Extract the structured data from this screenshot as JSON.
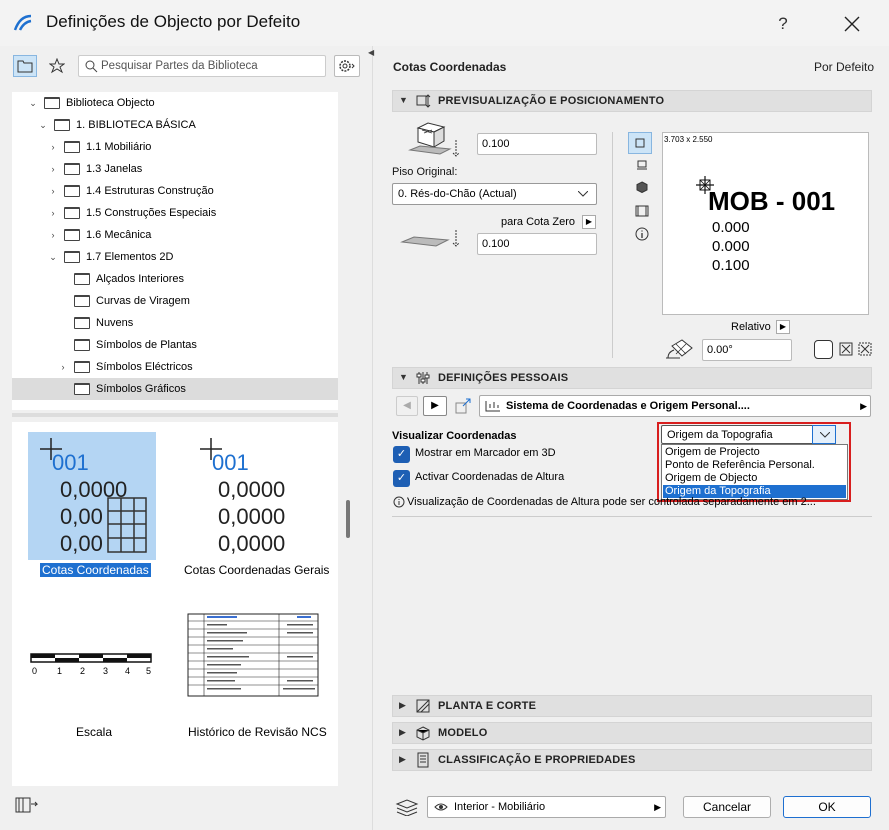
{
  "window": {
    "title": "Definições de Objecto por Defeito",
    "help": "?",
    "close": "✕"
  },
  "left": {
    "search_placeholder": "Pesquisar Partes da Biblioteca",
    "tree": [
      {
        "label": "Biblioteca Objecto",
        "expanded": true
      },
      {
        "label": "1. BIBLIOTECA BÁSICA",
        "expanded": true
      },
      {
        "label": "1.1 Mobiliário",
        "expanded": false
      },
      {
        "label": "1.3 Janelas",
        "expanded": false
      },
      {
        "label": "1.4 Estruturas Construção",
        "expanded": false
      },
      {
        "label": "1.5 Construções Especiais",
        "expanded": false
      },
      {
        "label": "1.6 Mecânica",
        "expanded": false
      },
      {
        "label": "1.7 Elementos 2D",
        "expanded": true
      },
      {
        "label": "Alçados Interiores"
      },
      {
        "label": "Curvas de Viragem"
      },
      {
        "label": "Nuvens"
      },
      {
        "label": "Símbolos de Plantas"
      },
      {
        "label": "Símbolos Eléctricos",
        "expanded": false
      },
      {
        "label": "Símbolos Gráficos",
        "selected": true
      }
    ],
    "thumbs": [
      {
        "label": "Cotas Coordenadas",
        "id": "001",
        "lines": [
          "0,0000",
          "0,00",
          "0,00"
        ]
      },
      {
        "label": "Cotas Coordenadas Gerais",
        "id": "001",
        "lines": [
          "0,0000",
          "0,0000",
          "0,0000"
        ]
      },
      {
        "label": "Escala",
        "ticks": [
          "0",
          "1",
          "2",
          "3",
          "4",
          "5"
        ]
      },
      {
        "label": "Histórico de Revisão NCS"
      }
    ]
  },
  "right": {
    "object_name": "Cotas Coordenadas",
    "default_label": "Por Defeito",
    "sections": {
      "preview": "PREVISUALIZAÇÃO E POSICIONAMENTO",
      "custom": "DEFINIÇÕES PESSOAIS",
      "plan": "PLANTA E CORTE",
      "model": "MODELO",
      "classification": "CLASSIFICAÇÃO E PROPRIEDADES"
    },
    "elevation_value": "0.100",
    "home_story_label": "Piso Original:",
    "home_story_value": "0. Rés-do-Chão (Actual)",
    "to_zero_label": "para Cota Zero",
    "zero_value": "0.100",
    "preview_size": "3.703 x 2.550",
    "preview_id": "MOB - 001",
    "preview_lines": [
      "0.000",
      "0.000",
      "0.100"
    ],
    "relative_label": "Relativo",
    "angle_value": "0.00°",
    "custom_dropdown": "Sistema de Coordenadas e Origem Personal....",
    "visualize_label": "Visualizar Coordenadas",
    "visualize_value": "Origem da Topografia",
    "visualize_options": [
      "Origem de Projecto",
      "Ponto de Referência Personal.",
      "Origem de Objecto",
      "Origem da Topografia"
    ],
    "show_3d_label": "Mostrar em Marcador em 3D",
    "activate_height_label": "Activar Coordenadas de Altura",
    "info_text": "Visualização de Coordenadas de Altura pode ser controlada separadamente em 2...",
    "layer_value": "Interior - Mobiliário",
    "cancel": "Cancelar",
    "ok": "OK"
  }
}
